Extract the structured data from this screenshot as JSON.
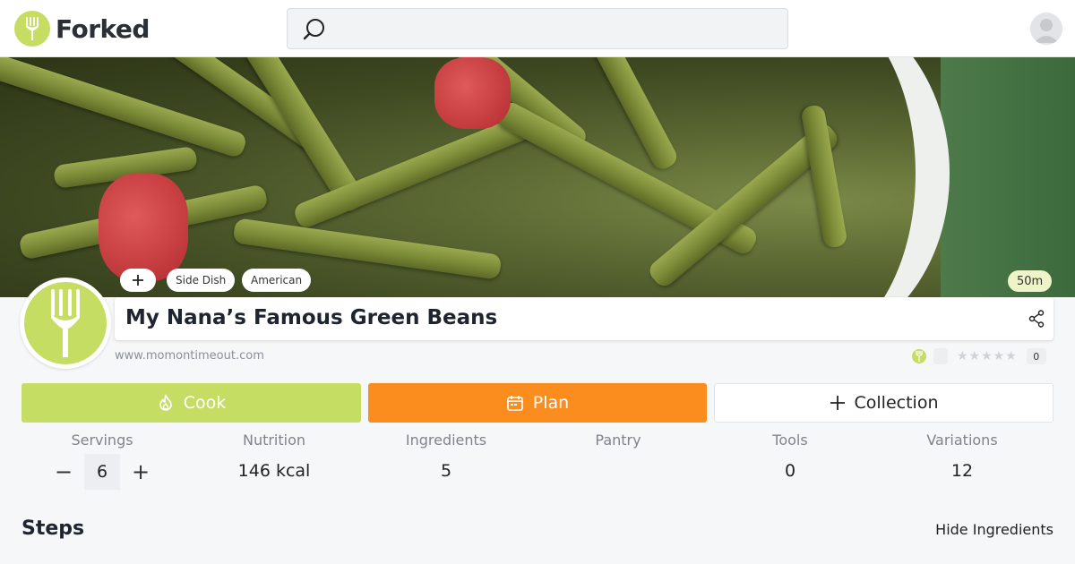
{
  "app": {
    "name": "Forked"
  },
  "header": {
    "search_placeholder": "",
    "search_value": ""
  },
  "hero": {
    "tags": [
      "Side Dish",
      "American"
    ],
    "add_tag_label": "+",
    "time": "50m"
  },
  "recipe": {
    "title": "My Nana’s Famous Green Beans",
    "source": "www.momontimeout.com",
    "rating_count": "0",
    "stars": "★★★★★"
  },
  "actions": {
    "cook": "Cook",
    "plan": "Plan",
    "collection": "Collection"
  },
  "stats": {
    "servings": {
      "label": "Servings",
      "value": "6",
      "minus": "−",
      "plus": "+"
    },
    "nutrition": {
      "label": "Nutrition",
      "value": "146 kcal"
    },
    "ingredients": {
      "label": "Ingredients",
      "value": "5"
    },
    "pantry": {
      "label": "Pantry",
      "value": ""
    },
    "tools": {
      "label": "Tools",
      "value": "0"
    },
    "variations": {
      "label": "Variations",
      "value": "12"
    }
  },
  "section": {
    "steps": "Steps",
    "hide_ingredients": "Hide Ingredients"
  },
  "colors": {
    "brand_green": "#c5dd63",
    "plan_orange": "#fb8c1e"
  }
}
